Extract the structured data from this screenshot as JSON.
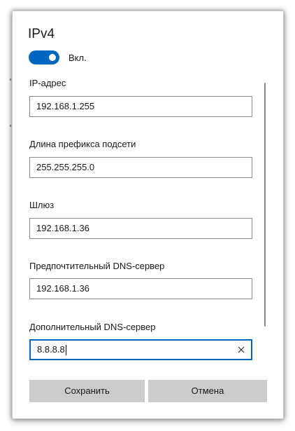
{
  "dialog": {
    "title": "IPv4",
    "toggle": {
      "label": "Вкл.",
      "on": true
    }
  },
  "fields": [
    {
      "label": "IP-адрес",
      "value": "192.168.1.255"
    },
    {
      "label": "Длина префикса подсети",
      "value": "255.255.255.0"
    },
    {
      "label": "Шлюз",
      "value": "192.168.1.36"
    },
    {
      "label": "Предпочтительный DNS-сервер",
      "value": "192.168.1.36"
    },
    {
      "label": "Дополнительный DNS-сервер",
      "value": "8.8.8.8"
    }
  ],
  "buttons": {
    "save": "Сохранить",
    "cancel": "Отмена"
  },
  "colors": {
    "accent": "#0067c0",
    "button_bg": "#cccccc"
  },
  "icons": {
    "clear": "close-icon"
  }
}
